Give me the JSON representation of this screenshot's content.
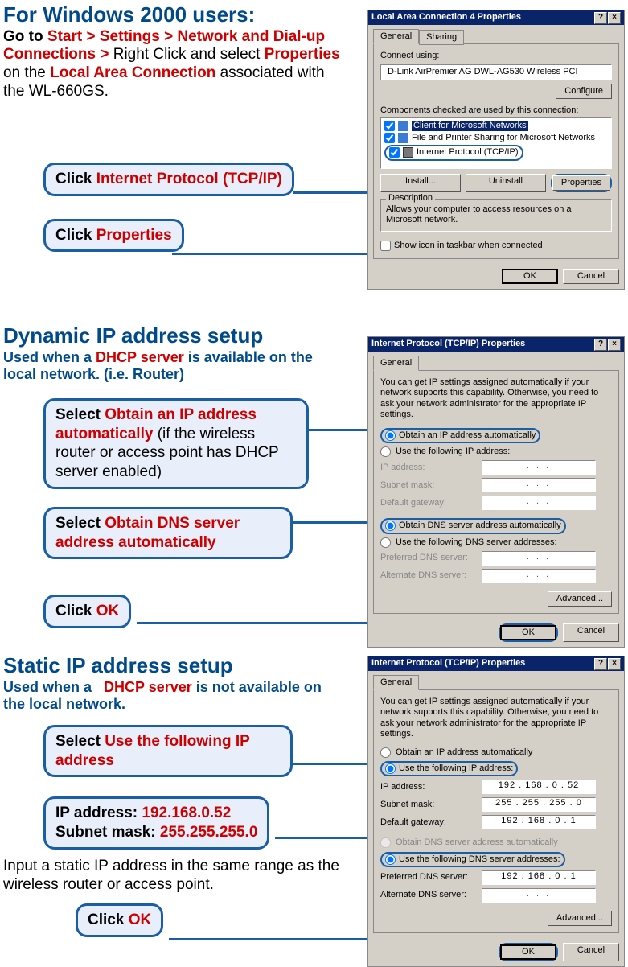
{
  "section1": {
    "heading": "For Windows 2000 users:",
    "intro": {
      "pre": "Go to ",
      "path": "Start > Settings > Network and Dial-up Connections > ",
      "mid1": "Right Click and select ",
      "props": "Properties",
      "mid2": " on the ",
      "lac": "Local Area Connection",
      "tail": " associated with the WL-660GS."
    },
    "callout1": {
      "pre": "Click ",
      "red": "Internet Protocol (TCP/IP)"
    },
    "callout2": {
      "pre": "Click ",
      "red": "Properties"
    },
    "dialog": {
      "title": "Local Area Connection 4 Properties",
      "tab_general": "General",
      "tab_sharing": "Sharing",
      "connect_using_label": "Connect using:",
      "adapter": "D-Link AirPremier AG DWL-AG530 Wireless PCI",
      "configure": "Configure",
      "components_label": "Components checked are used by this connection:",
      "items": {
        "client": "Client for Microsoft Networks",
        "file": "File and Printer Sharing for Microsoft Networks",
        "tcpip": "Internet Protocol (TCP/IP)"
      },
      "install": "Install...",
      "uninstall": "Uninstall",
      "properties": "Properties",
      "desc_legend": "Description",
      "desc_text": "Allows your computer to access resources on a Microsoft network.",
      "showicon": "Show icon in taskbar when connected",
      "ok": "OK",
      "cancel": "Cancel"
    }
  },
  "section2": {
    "heading": "Dynamic IP address setup",
    "sub": {
      "pre": "Used when a ",
      "red": "DHCP server",
      "post": " is available on the local network. (i.e. Router)"
    },
    "callout1": {
      "b": "Select ",
      "red": "Obtain an IP address automatically",
      "rest": " (if the wireless router or access point has DHCP server enabled)"
    },
    "callout2": {
      "b": "Select ",
      "red": "Obtain DNS server address automatically"
    },
    "callout3": {
      "b": "Click ",
      "red": "OK"
    },
    "dialog": {
      "title": "Internet Protocol (TCP/IP) Properties",
      "tab_general": "General",
      "intro": "You can get IP settings assigned automatically if your network supports this capability. Otherwise, you need to ask your network administrator for the appropriate IP settings.",
      "r_obtain_ip": "Obtain an IP address automatically",
      "r_use_ip": "Use the following IP address:",
      "ip_label": "IP address:",
      "mask_label": "Subnet mask:",
      "gw_label": "Default gateway:",
      "r_obtain_dns": "Obtain DNS server address automatically",
      "r_use_dns": "Use the following DNS server addresses:",
      "pdns": "Preferred DNS server:",
      "adns": "Alternate DNS server:",
      "advanced": "Advanced...",
      "ok": "OK",
      "cancel": "Cancel"
    }
  },
  "section3": {
    "heading": "Static IP address setup",
    "sub": {
      "pre": "Used when a ",
      "red": "DHCP server",
      "post": " is not available on the local network."
    },
    "callout1": {
      "b": "Select ",
      "red": "Use the following IP address"
    },
    "callout2": {
      "l1a": "IP address: ",
      "l1b": "192.168.0.52",
      "l2a": "Subnet mask: ",
      "l2b": "255.255.255.0"
    },
    "body": "Input a static IP address in the same range as the wireless router or access point.",
    "callout3": {
      "b": "Click ",
      "red": "OK"
    },
    "dialog": {
      "title": "Internet Protocol (TCP/IP) Properties",
      "tab_general": "General",
      "intro": "You can get IP settings assigned automatically if your network supports this capability. Otherwise, you need to ask your network administrator for the appropriate IP settings.",
      "r_obtain_ip": "Obtain an IP address automatically",
      "r_use_ip": "Use the following IP address:",
      "ip_label": "IP address:",
      "ip_val": "192 . 168 .  0  . 52",
      "mask_label": "Subnet mask:",
      "mask_val": "255 . 255 . 255 .  0",
      "gw_label": "Default gateway:",
      "gw_val": "192 . 168 .  0  .  1",
      "r_obtain_dns": "Obtain DNS server address automatically",
      "r_use_dns": "Use the following DNS server addresses:",
      "pdns": "Preferred DNS server:",
      "pdns_val": "192 . 168 .  0  .  1",
      "adns": "Alternate DNS server:",
      "advanced": "Advanced...",
      "ok": "OK",
      "cancel": "Cancel"
    }
  }
}
